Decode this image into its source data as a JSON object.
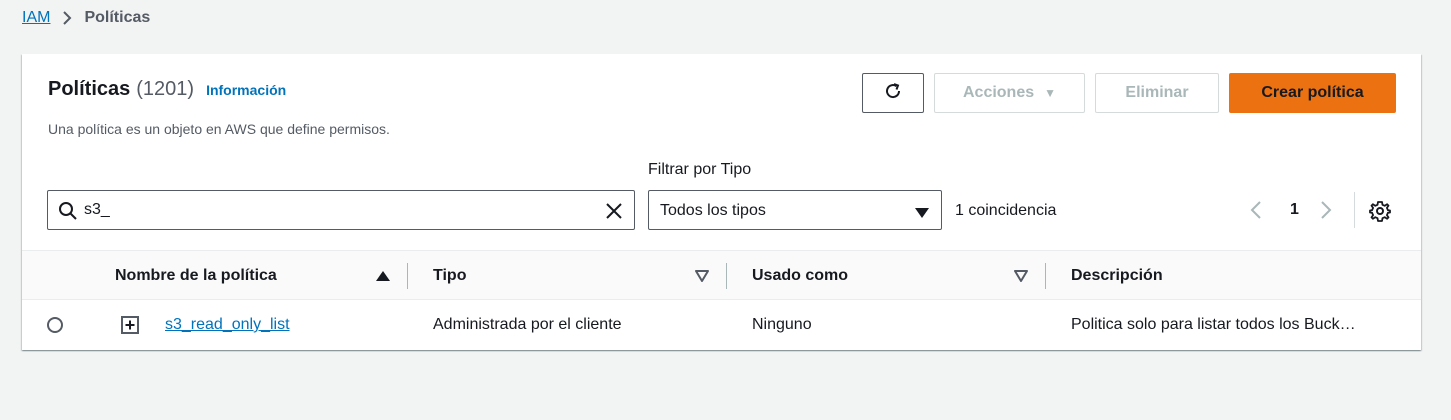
{
  "breadcrumb": {
    "root": "IAM",
    "current": "Políticas"
  },
  "header": {
    "title": "Políticas",
    "count": "(1201)",
    "info_link": "Información",
    "description": "Una política es un objeto en AWS que define permisos."
  },
  "toolbar": {
    "refresh_icon": "refresh-icon",
    "actions_label": "Acciones",
    "delete_label": "Eliminar",
    "create_label": "Crear política"
  },
  "filters": {
    "search_value": "s3_",
    "type_label": "Filtrar por Tipo",
    "type_selected": "Todos los tipos",
    "match_count": "1 coincidencia"
  },
  "pagination": {
    "current_page": "1"
  },
  "table": {
    "columns": [
      "Nombre de la política",
      "Tipo",
      "Usado como",
      "Descripción"
    ],
    "rows": [
      {
        "name": "s3_read_only_list",
        "type": "Administrada por el cliente",
        "used_as": "Ninguno",
        "description": "Politica solo para listar todos los Buck…"
      }
    ]
  },
  "colors": {
    "accent": "#ec7211",
    "link": "#0073bb",
    "text": "#16191f",
    "muted": "#545b64",
    "disabled": "#aab7b8",
    "background": "#f2f3f3"
  }
}
